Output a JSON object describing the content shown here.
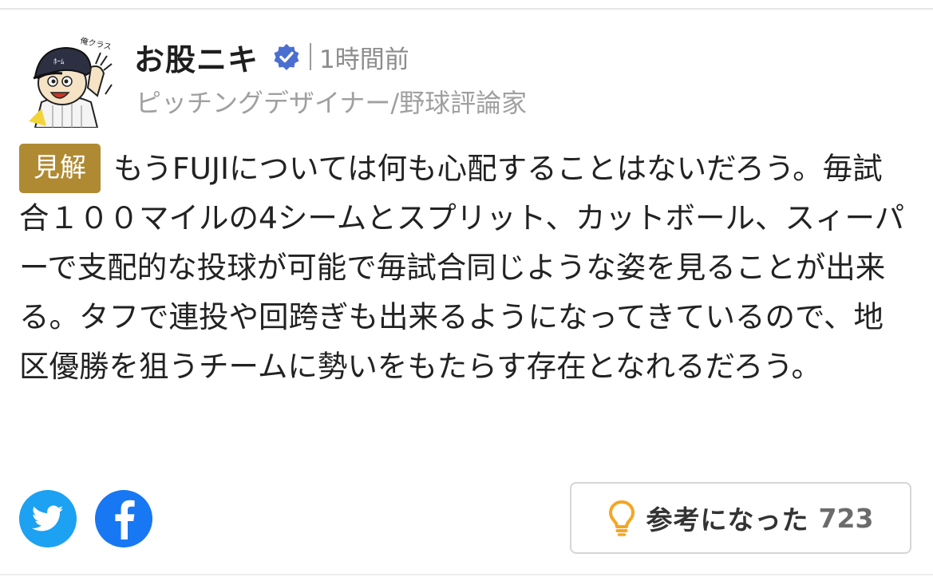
{
  "comment": {
    "author": {
      "name": "お股ニキ",
      "verified": true,
      "profile": "ピッチングデザイナー/野球評論家",
      "avatar_caption": "俺クラス"
    },
    "posted": "1時間前",
    "badge": "見解",
    "badge_color": "#b08a33",
    "text": "もうFUJIについては何も心配することはないだろう。毎試合１００マイルの4シームとスプリット、カットボール、スィーパーで支配的な投球が可能で毎試合同じような姿を見ることが出来る。タフで連投や回跨ぎも出来るようになってきているので、地区優勝を狙うチームに勢いをもたらす存在となれるだろう。",
    "share": {
      "twitter_icon": "twitter-icon",
      "facebook_icon": "facebook-icon",
      "twitter_color": "#1da1f2",
      "facebook_color": "#1877f2"
    },
    "helpful": {
      "icon": "lightbulb-icon",
      "icon_color": "#f5a623",
      "label": "参考になった",
      "count": "723"
    }
  }
}
